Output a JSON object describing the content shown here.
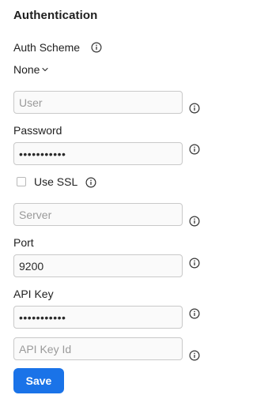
{
  "section": {
    "title": "Authentication"
  },
  "auth_scheme": {
    "label": "Auth Scheme",
    "value": "None"
  },
  "user": {
    "placeholder": "User",
    "value": ""
  },
  "password": {
    "label": "Password",
    "masked_value": "•••••••••••"
  },
  "use_ssl": {
    "label": "Use SSL",
    "checked": false
  },
  "server": {
    "placeholder": "Server",
    "value": ""
  },
  "port": {
    "label": "Port",
    "value": "9200"
  },
  "api_key": {
    "label": "API Key",
    "masked_value": "•••••••••••"
  },
  "api_key_id": {
    "placeholder": "API Key Id",
    "value": ""
  },
  "actions": {
    "save_label": "Save"
  },
  "colors": {
    "primary_button": "#1a73e8",
    "field_border": "#c9c9c9",
    "placeholder_text": "#9a9a9a",
    "info_icon": "#333333"
  },
  "icons": {
    "info": "info-circle-icon",
    "dropdown": "chevron-down-icon"
  }
}
